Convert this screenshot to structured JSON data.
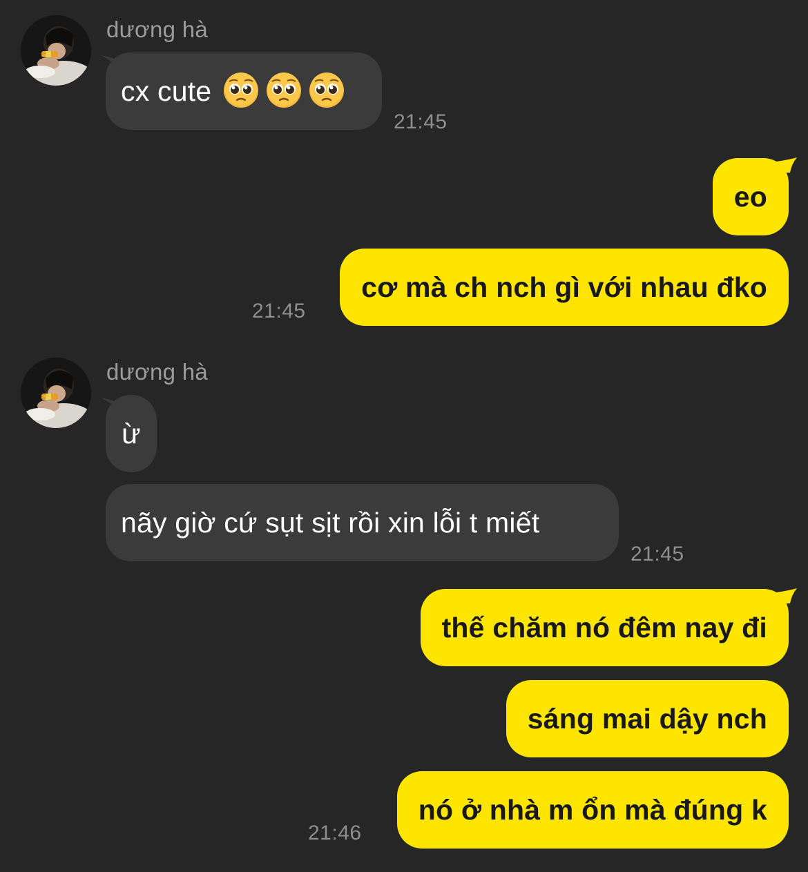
{
  "conversation": {
    "messages": [
      {
        "sender_name": "dương hà",
        "text": "cx cute",
        "emoji": [
          "pleading-face",
          "pleading-face",
          "pleading-face"
        ],
        "time": "21:45"
      },
      {
        "text": "eo"
      },
      {
        "text": "cơ mà ch nch gì với nhau đko",
        "time": "21:45"
      },
      {
        "sender_name": "dương hà",
        "text": "ừ"
      },
      {
        "text": "nãy giờ cứ sụt sịt rồi xin lỗi t miết",
        "time": "21:45"
      },
      {
        "text": "thế chăm nó đêm nay đi"
      },
      {
        "text": "sáng mai dậy nch"
      },
      {
        "text": "nó ở nhà m ổn mà đúng k",
        "time": "21:46"
      }
    ]
  },
  "colors": {
    "background": "#262626",
    "incoming_bubble": "#3b3b3b",
    "outgoing_bubble": "#fee500",
    "timestamp": "#8e8e8e",
    "sender_name": "#9b9b9b"
  }
}
